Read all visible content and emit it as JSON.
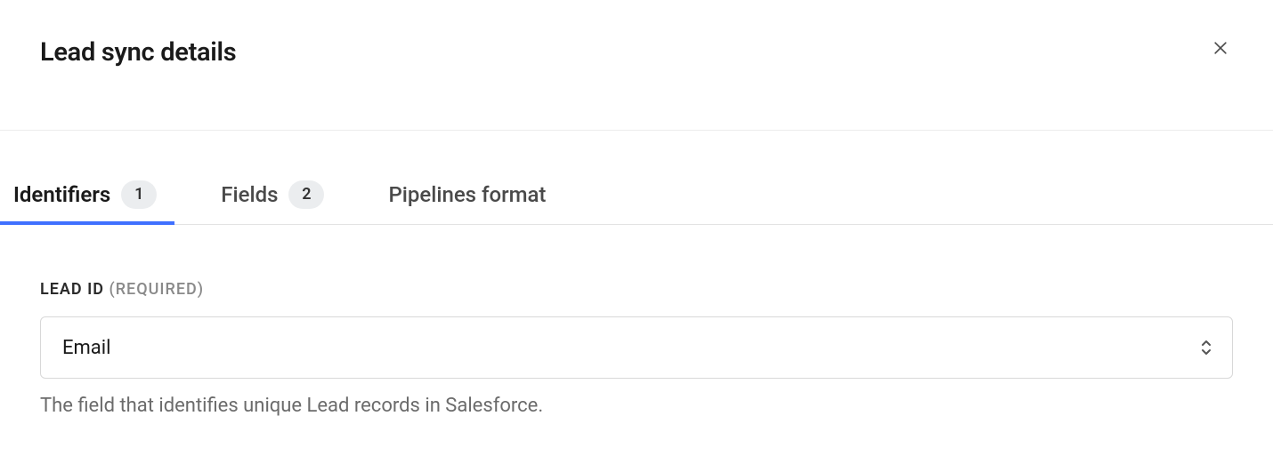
{
  "header": {
    "title": "Lead sync details"
  },
  "tabs": [
    {
      "label": "Identifiers",
      "count": "1",
      "active": true
    },
    {
      "label": "Fields",
      "count": "2",
      "active": false
    },
    {
      "label": "Pipelines format",
      "count": null,
      "active": false
    }
  ],
  "lead_id": {
    "label": "LEAD ID",
    "required": "(REQUIRED)",
    "value": "Email",
    "helper": "The field that identifies unique Lead records in Salesforce."
  }
}
